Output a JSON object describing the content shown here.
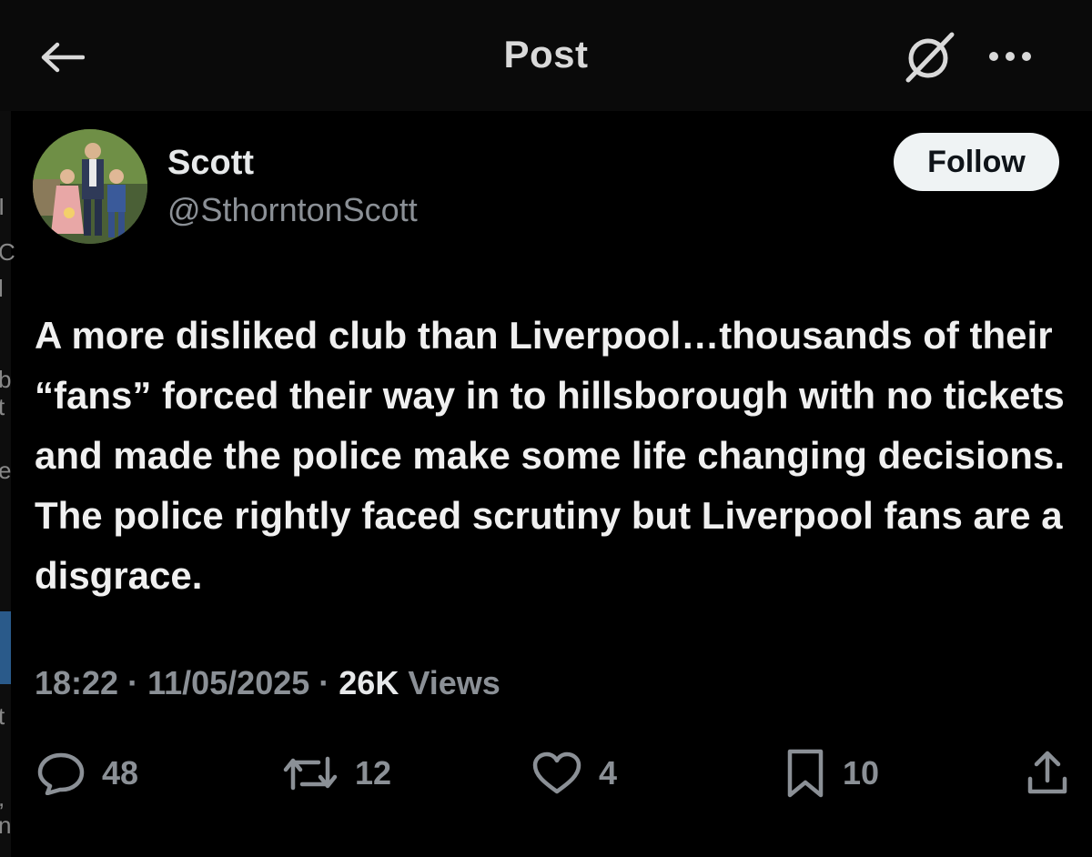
{
  "header": {
    "title": "Post",
    "back_icon": "arrow-left-icon",
    "grok_icon": "grok-icon",
    "more_icon": "more-icon"
  },
  "author": {
    "name": "Scott",
    "handle": "@SthorntonScott",
    "follow_label": "Follow"
  },
  "post": {
    "text": "A more disliked club than Liverpool…thousands of their “fans” forced their way in to hillsborough with no tickets and made the police make some life changing decisions. The police rightly faced scrutiny but Liverpool fans are a disgrace.",
    "time": "18:22",
    "date": "11/05/2025",
    "views_count": "26K",
    "views_label": "Views",
    "separator": "·"
  },
  "actions": {
    "replies": "48",
    "reposts": "12",
    "likes": "4",
    "bookmarks": "10"
  },
  "colors": {
    "background": "#000000",
    "muted_text": "#8b9096",
    "primary_text": "#e7e9ea",
    "follow_bg": "#eff3f4"
  }
}
